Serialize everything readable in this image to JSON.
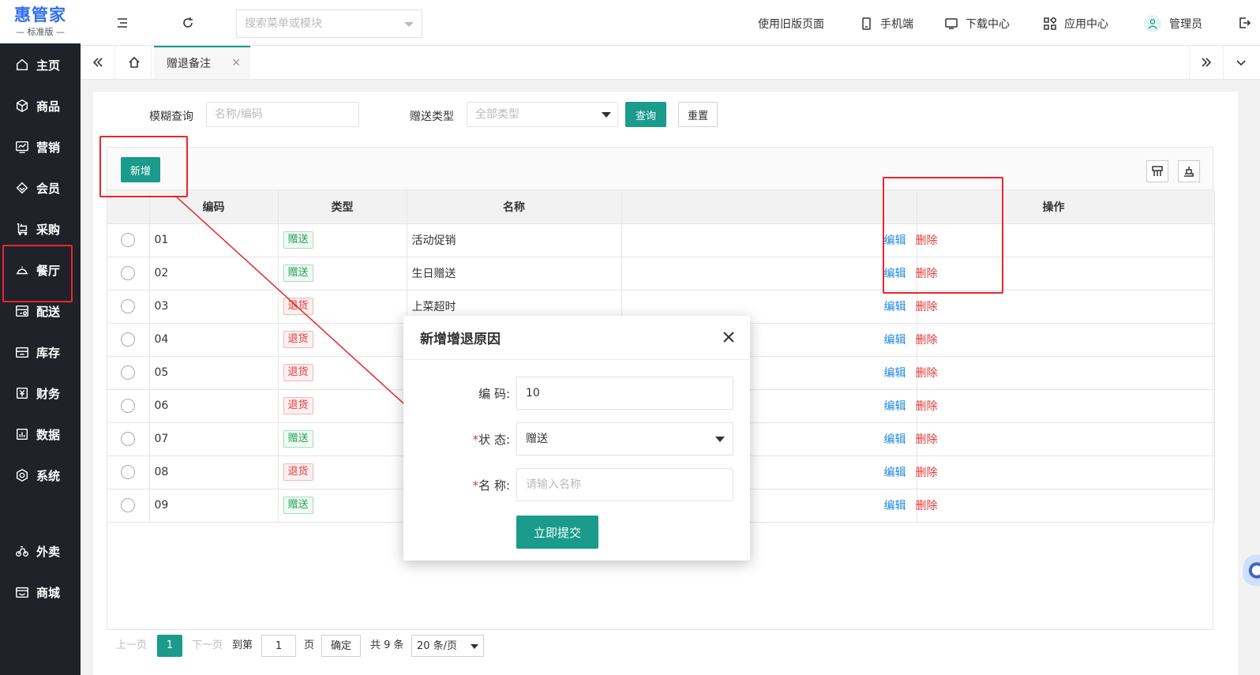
{
  "logo": {
    "title": "惠管家",
    "subtitle": "标准版"
  },
  "sidebar": {
    "items": [
      {
        "label": "主页",
        "icon": "home-icon"
      },
      {
        "label": "商品",
        "icon": "box-icon"
      },
      {
        "label": "营销",
        "icon": "chart-icon"
      },
      {
        "label": "会员",
        "icon": "diamond-icon"
      },
      {
        "label": "采购",
        "icon": "cart-icon"
      },
      {
        "label": "餐厅",
        "icon": "cloche-icon"
      },
      {
        "label": "配送",
        "icon": "delivery-icon"
      },
      {
        "label": "库存",
        "icon": "warehouse-icon"
      },
      {
        "label": "财务",
        "icon": "yen-icon"
      },
      {
        "label": "数据",
        "icon": "bar-chart-icon"
      },
      {
        "label": "系统",
        "icon": "settings-icon"
      },
      {
        "label": "外卖",
        "icon": "bike-icon"
      },
      {
        "label": "商城",
        "icon": "shop-icon"
      }
    ]
  },
  "header": {
    "search_placeholder": "搜索菜单或模块",
    "links": {
      "old_page": "使用旧版页面",
      "mobile": "手机端",
      "download": "下载中心",
      "app_center": "应用中心",
      "user": "管理员"
    }
  },
  "tabs": {
    "active": "赠退备注"
  },
  "filters": {
    "fuzzy_label": "模糊查询",
    "fuzzy_placeholder": "名称/编码",
    "type_label": "赠送类型",
    "type_value": "全部类型",
    "query_button": "查询",
    "reset_button": "重置"
  },
  "toolbar": {
    "add_button": "新增"
  },
  "table": {
    "headers": {
      "code": "编码",
      "type": "类型",
      "name": "名称",
      "ops": "操作"
    },
    "edit_label": "编辑",
    "delete_label": "删除",
    "rows": [
      {
        "code": "01",
        "type": "赠送",
        "kind": "give",
        "name": "活动促销"
      },
      {
        "code": "02",
        "type": "赠送",
        "kind": "give",
        "name": "生日赠送"
      },
      {
        "code": "03",
        "type": "退货",
        "kind": "return",
        "name": "上菜超时"
      },
      {
        "code": "04",
        "type": "退货",
        "kind": "return",
        "name": ""
      },
      {
        "code": "05",
        "type": "退货",
        "kind": "return",
        "name": ""
      },
      {
        "code": "06",
        "type": "退货",
        "kind": "return",
        "name": ""
      },
      {
        "code": "07",
        "type": "赠送",
        "kind": "give",
        "name": ""
      },
      {
        "code": "08",
        "type": "退货",
        "kind": "return",
        "name": ""
      },
      {
        "code": "09",
        "type": "赠送",
        "kind": "give",
        "name": ""
      }
    ]
  },
  "pager": {
    "prev": "上一页",
    "current": "1",
    "next": "下一页",
    "goto": "到第",
    "page_input": "1",
    "page_unit": "页",
    "confirm": "确定",
    "total": "共 9 条",
    "page_size": "20 条/页"
  },
  "modal": {
    "title": "新增增退原因",
    "code_label": "编 码:",
    "code_value": "10",
    "status_label": "状 态:",
    "status_value": "赠送",
    "name_label": "名 称:",
    "name_placeholder": "请输入名称",
    "required_mark": "*",
    "submit": "立即提交"
  },
  "colors": {
    "primary": "#1a9b8c",
    "annotation": "#e8262b",
    "sidebar_bg": "#1f2229"
  }
}
